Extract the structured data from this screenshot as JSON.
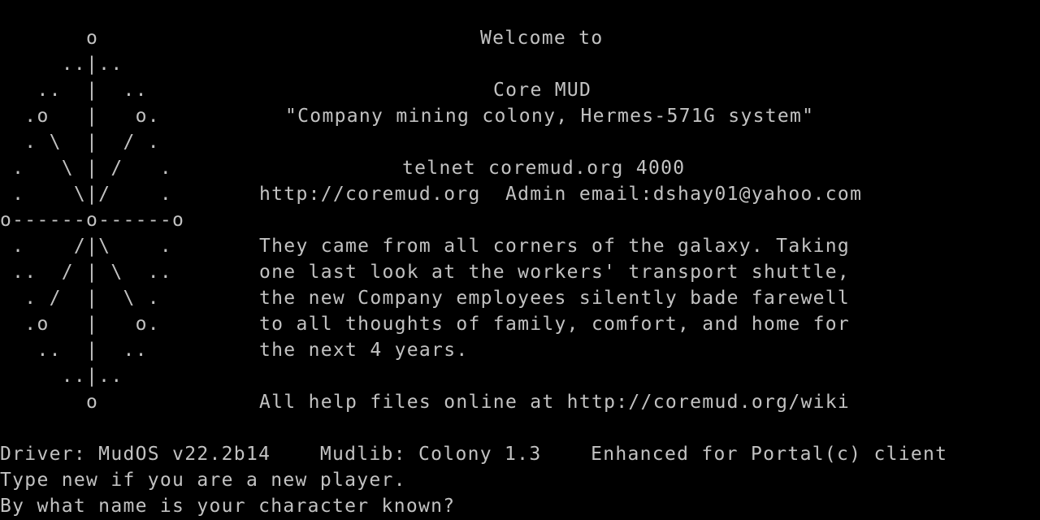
{
  "theme": {
    "background": "#000000",
    "foreground": "#c2c2c2"
  },
  "art": [
    "       o",
    "     ..|..",
    "   ..  |  ..",
    "  .o   |   o.",
    "  . \\  |  / .",
    " .   \\ | /   .",
    " .    \\|/    .",
    "o------o------o",
    " .    /|\\    .",
    " ..  / | \\  ..",
    "  . /  |  \\ .",
    "  .o   |   o.",
    "   ..  |  ..",
    "     ..|..",
    "       o"
  ],
  "banner": {
    "welcome": "Welcome to",
    "mud_name": "Core MUD",
    "tagline": "\"Company mining colony, Hermes-571G system\"",
    "telnet": "telnet coremud.org 4000",
    "contact": "http://coremud.org  Admin email:dshay01@yahoo.com"
  },
  "story": [
    "They came from all corners of the galaxy. Taking",
    "one last look at the workers' transport shuttle,",
    "the new Company employees silently bade farewell",
    "to all thoughts of family, comfort, and home for",
    "the next 4 years."
  ],
  "help": "All help files online at http://coremud.org/wiki",
  "info": {
    "driver": "Driver: MudOS v22.2b14    Mudlib: Colony 1.3    Enhanced for Portal(c) client"
  },
  "prompts": {
    "new_player": "Type new if you are a new player.",
    "name_prompt": "By what name is your character known?"
  }
}
